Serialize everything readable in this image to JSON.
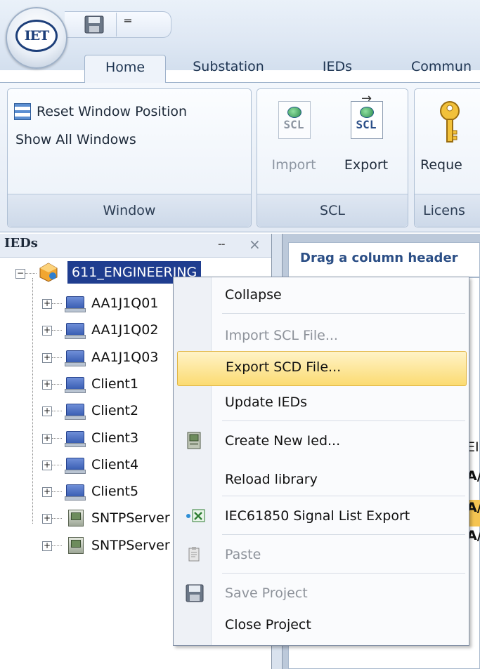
{
  "app": {
    "logo_text": "IET"
  },
  "ribbon": {
    "tabs": [
      {
        "label": "Home",
        "active": true
      },
      {
        "label": "Substation"
      },
      {
        "label": "IEDs"
      },
      {
        "label": "Commun"
      }
    ],
    "groups": {
      "window": {
        "label": "Window",
        "reset_label": "Reset Window Position",
        "show_all_label": "Show All Windows"
      },
      "scl": {
        "label": "SCL",
        "import_label": "Import",
        "export_label": "Export",
        "icon_text": "SCL"
      },
      "license": {
        "label": "Licens",
        "request_label": "Reque"
      }
    }
  },
  "ieds_panel": {
    "title": "IEDs",
    "pin_glyph": "ⵧ",
    "close_glyph": "×",
    "root": {
      "label": "611_ENGINEERING",
      "expander": "−"
    },
    "nodes": [
      {
        "label": "AA1J1Q01",
        "icon": "pc-icon"
      },
      {
        "label": "AA1J1Q02",
        "icon": "pc-icon"
      },
      {
        "label": "AA1J1Q03",
        "icon": "pc-icon"
      },
      {
        "label": "Client1",
        "icon": "pc-icon"
      },
      {
        "label": "Client2",
        "icon": "pc-icon"
      },
      {
        "label": "Client3",
        "icon": "pc-icon"
      },
      {
        "label": "Client4",
        "icon": "pc-icon"
      },
      {
        "label": "Client5",
        "icon": "pc-icon"
      },
      {
        "label": "SNTPServer",
        "icon": "server-icon"
      },
      {
        "label": "SNTPServer",
        "icon": "server-icon"
      }
    ],
    "expander": "+"
  },
  "grid": {
    "hint": "Drag a column header",
    "cells": [
      "EI",
      "A/",
      "A/",
      "A/"
    ],
    "highlight_color": "#f5c451"
  },
  "context_menu": {
    "items": [
      {
        "label": "Collapse",
        "enabled": true
      },
      {
        "label": "Import SCL File...",
        "enabled": false
      },
      {
        "label": "Export SCD File...",
        "enabled": true,
        "highlighted": true
      },
      {
        "label": "Update IEDs",
        "enabled": true
      },
      {
        "label": "Create New Ied...",
        "enabled": true,
        "icon": "server-icon"
      },
      {
        "label": "Reload library",
        "enabled": true
      },
      {
        "label": "IEC61850 Signal List Export",
        "enabled": true,
        "icon": "excel-export-icon"
      },
      {
        "label": "Paste",
        "enabled": false,
        "icon": "clipboard-icon"
      },
      {
        "label": "Save Project",
        "enabled": false,
        "icon": "save-icon"
      },
      {
        "label": "Close Project",
        "enabled": true
      }
    ]
  },
  "qat": {
    "more_glyph": "═"
  }
}
